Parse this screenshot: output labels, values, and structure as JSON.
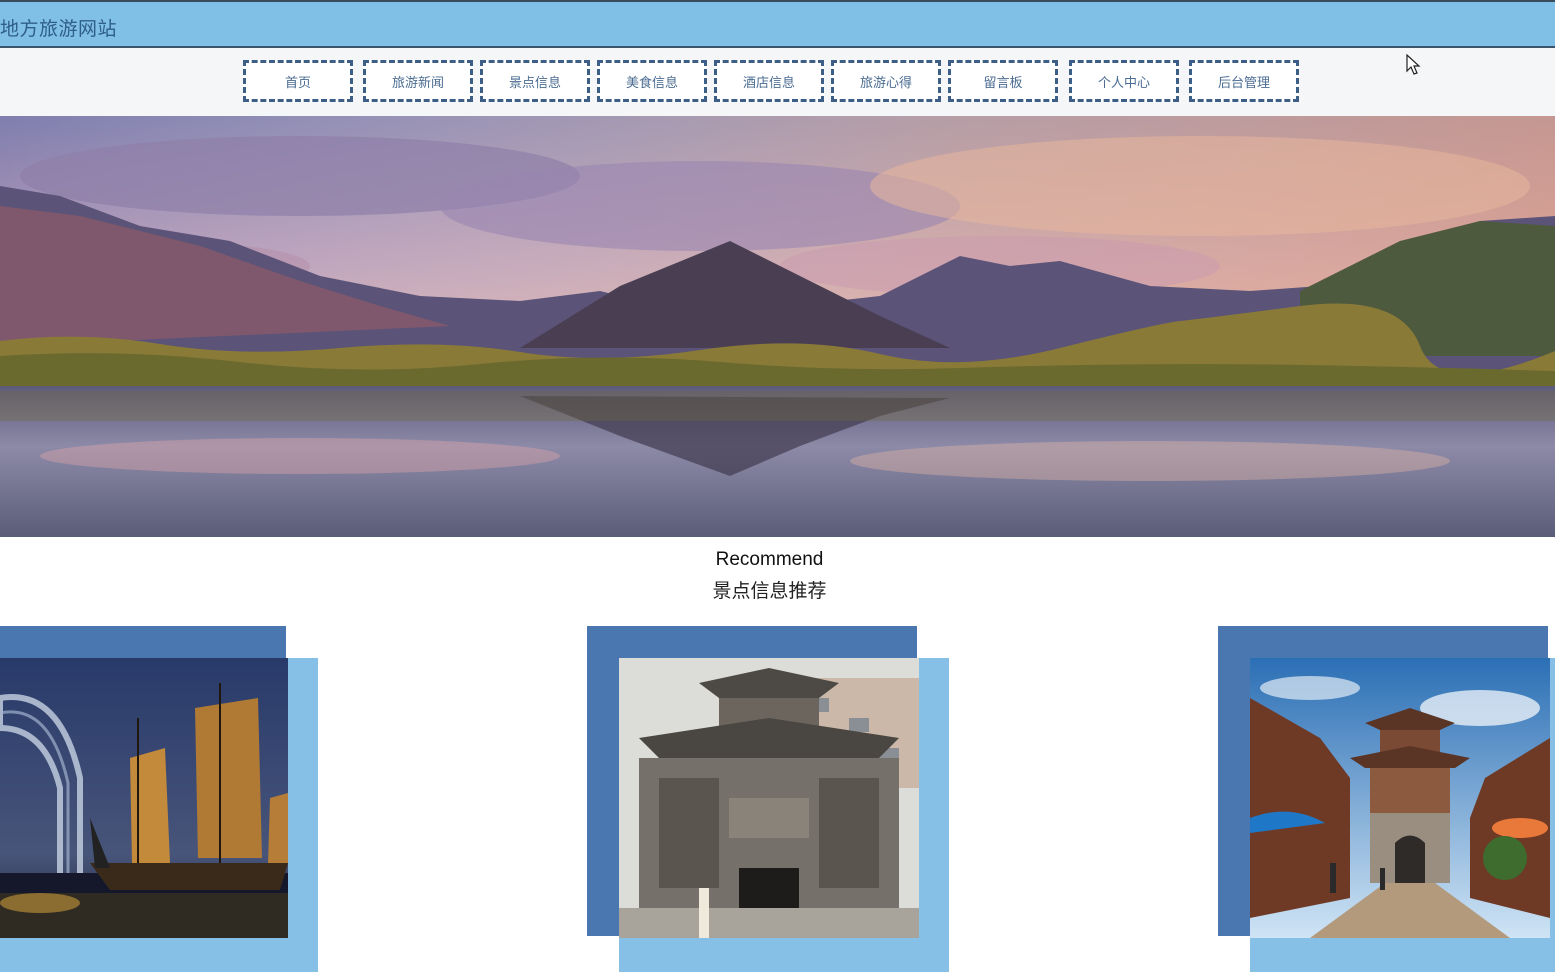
{
  "header": {
    "site_title": "地方旅游网站"
  },
  "nav": {
    "items": [
      {
        "label": "首页"
      },
      {
        "label": "旅游新闻"
      },
      {
        "label": "景点信息"
      },
      {
        "label": "美食信息"
      },
      {
        "label": "酒店信息"
      },
      {
        "label": "旅游心得"
      },
      {
        "label": "留言板"
      },
      {
        "label": "个人中心"
      },
      {
        "label": "后台管理"
      }
    ]
  },
  "banner": {
    "slide_count": 3,
    "active_slide": 2
  },
  "recommend": {
    "title_en": "Recommend",
    "title_cn": "景点信息推荐"
  },
  "colors": {
    "header_bg": "#80bfe6",
    "nav_border": "#3d5e86",
    "card_dark": "#4a77b0",
    "card_light": "#86c0e6",
    "dot_active": "#1b7fd4"
  }
}
